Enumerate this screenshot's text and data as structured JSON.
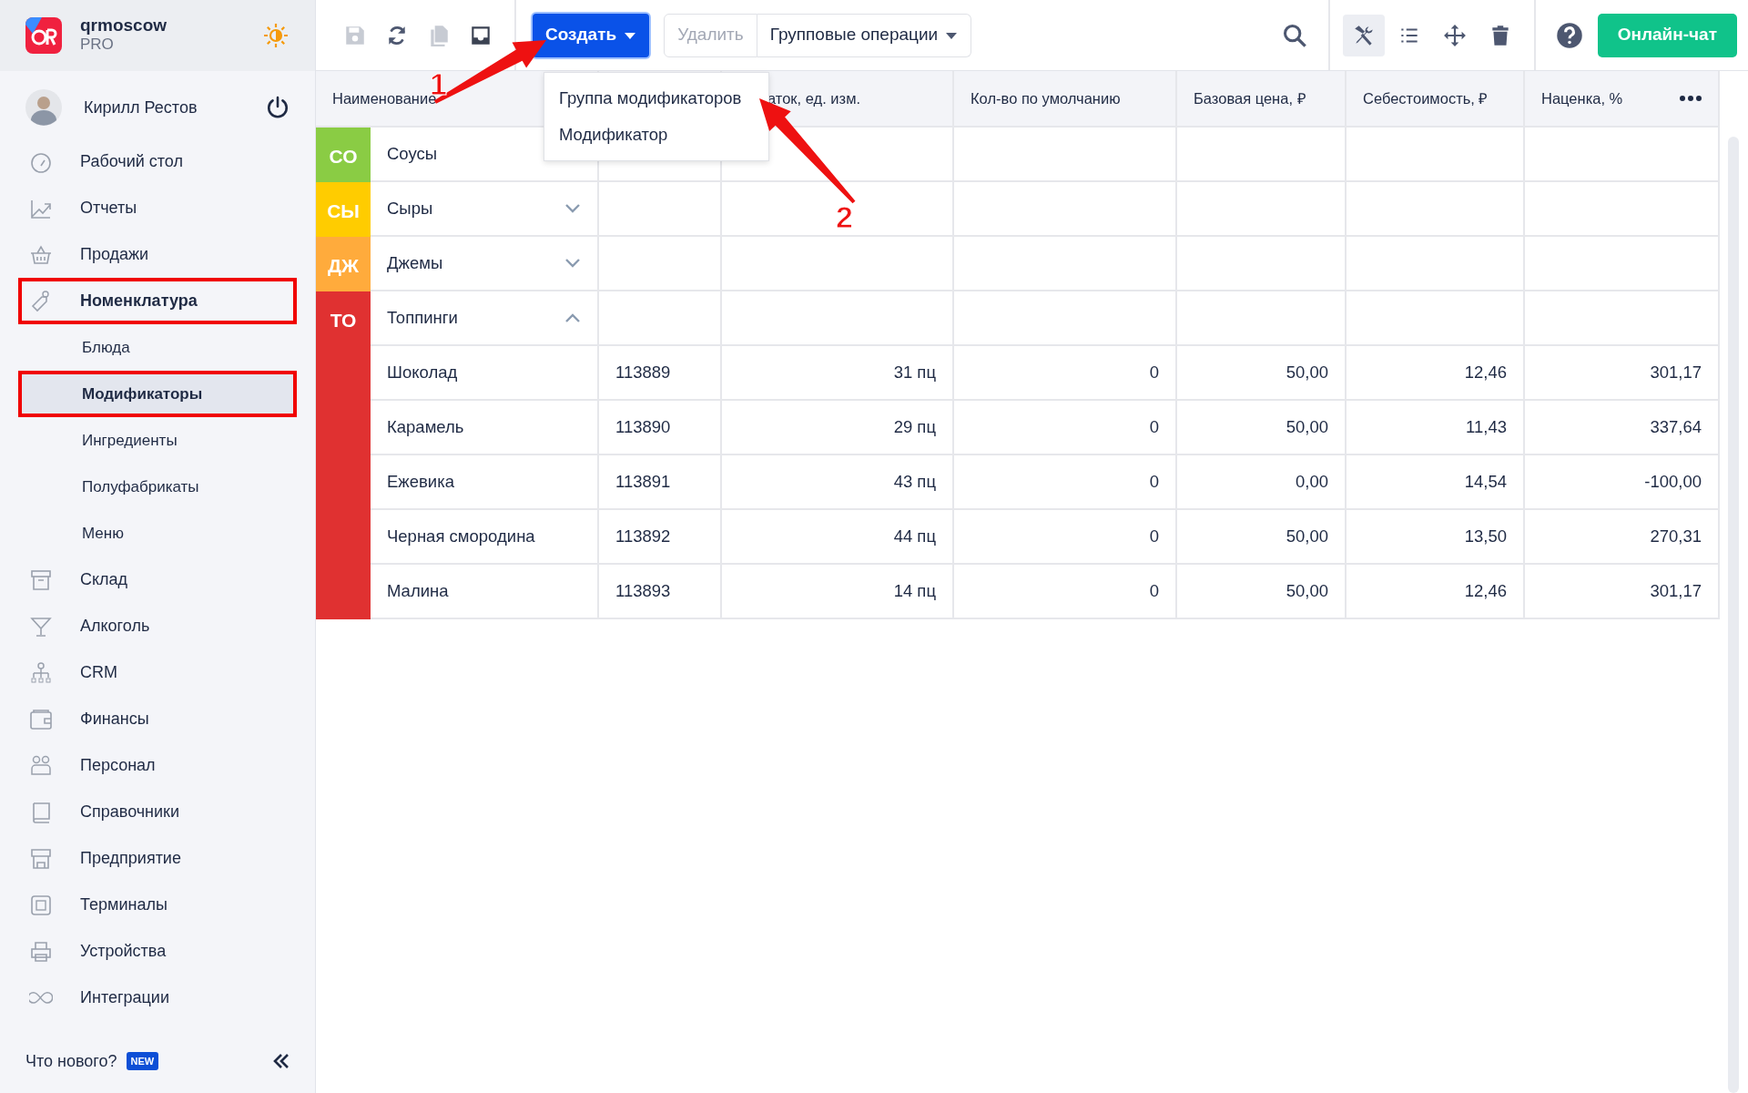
{
  "brand": {
    "name": "qrmoscow",
    "plan": "PRO"
  },
  "user": {
    "name": "Кирилл Рестов"
  },
  "sidebar": {
    "items": [
      {
        "label": "Рабочий стол",
        "selected": false,
        "highlighted": false
      },
      {
        "label": "Отчеты",
        "selected": false,
        "highlighted": false
      },
      {
        "label": "Продажи",
        "selected": false,
        "highlighted": false
      },
      {
        "label": "Номенклатура",
        "selected": false,
        "highlighted": true,
        "expanded": true,
        "children": [
          {
            "label": "Блюда",
            "selected": false,
            "highlighted": false
          },
          {
            "label": "Модификаторы",
            "selected": true,
            "highlighted": true
          },
          {
            "label": "Ингредиенты",
            "selected": false,
            "highlighted": false
          },
          {
            "label": "Полуфабрикаты",
            "selected": false,
            "highlighted": false
          },
          {
            "label": "Меню",
            "selected": false,
            "highlighted": false
          }
        ]
      },
      {
        "label": "Склад",
        "selected": false,
        "highlighted": false
      },
      {
        "label": "Алкоголь",
        "selected": false,
        "highlighted": false
      },
      {
        "label": "CRM",
        "selected": false,
        "highlighted": false
      },
      {
        "label": "Финансы",
        "selected": false,
        "highlighted": false
      },
      {
        "label": "Персонал",
        "selected": false,
        "highlighted": false
      },
      {
        "label": "Справочники",
        "selected": false,
        "highlighted": false
      },
      {
        "label": "Предприятие",
        "selected": false,
        "highlighted": false
      },
      {
        "label": "Терминалы",
        "selected": false,
        "highlighted": false
      },
      {
        "label": "Устройства",
        "selected": false,
        "highlighted": false
      },
      {
        "label": "Интеграции",
        "selected": false,
        "highlighted": false
      }
    ],
    "footer": {
      "label": "Что нового?",
      "badge": "NEW"
    }
  },
  "toolbar": {
    "left_buttons": [
      {
        "disabled": true
      },
      {
        "disabled": false
      },
      {
        "disabled": true
      },
      {
        "disabled": false
      }
    ],
    "create": {
      "label": "Создать",
      "expanded": true,
      "menu": [
        "Группа модификаторов",
        "Модификатор"
      ]
    },
    "delete": {
      "label": "Удалить",
      "disabled": true
    },
    "group_ops": {
      "label": "Групповые операции"
    },
    "right_buttons": [
      {
        "selected": true
      },
      {
        "selected": false
      },
      {
        "selected": false
      },
      {
        "selected": false
      }
    ],
    "chat": {
      "label": "Онлайн-чат"
    }
  },
  "table": {
    "columns": [
      "Наименование",
      "аток, ед. изм.",
      "Кол-во по умолчанию",
      "Базовая цена, ₽",
      "Себестоимость, ₽",
      "Наценка, %"
    ],
    "groups": [
      {
        "badge": "СО",
        "color": "#8acc44",
        "name": "Соусы"
      },
      {
        "badge": "СЫ",
        "color": "#ffcc00",
        "name": "Сыры",
        "expanded": false
      },
      {
        "badge": "ДЖ",
        "color": "#ffab3c",
        "name": "Джемы",
        "expanded": false
      },
      {
        "badge": "ТО",
        "color": "#e03131",
        "name": "Топпинги",
        "expanded": true,
        "children": [
          {
            "cells": [
              "Шоколад",
              "113889",
              "31 пц",
              "0",
              "50,00",
              "12,46",
              "301,17"
            ]
          },
          {
            "cells": [
              "Карамель",
              "113890",
              "29 пц",
              "0",
              "50,00",
              "11,43",
              "337,64"
            ]
          },
          {
            "cells": [
              "Ежевика",
              "113891",
              "43 пц",
              "0",
              "0,00",
              "14,54",
              "-100,00"
            ]
          },
          {
            "cells": [
              "Черная смородина",
              "113892",
              "44 пц",
              "0",
              "50,00",
              "13,50",
              "270,31"
            ]
          },
          {
            "cells": [
              "Малина",
              "113893",
              "14 пц",
              "0",
              "50,00",
              "12,46",
              "301,17"
            ]
          }
        ]
      }
    ]
  },
  "annotations": [
    {
      "label": "1"
    },
    {
      "label": "2"
    }
  ]
}
